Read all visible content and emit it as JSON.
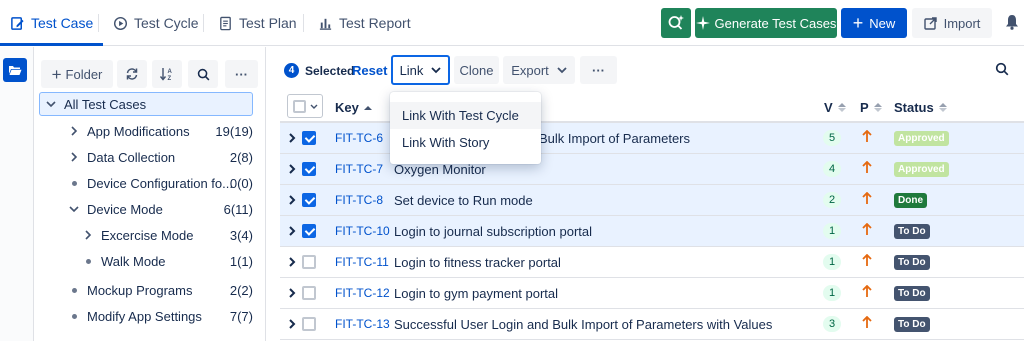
{
  "tabs": [
    {
      "label": "Test Case",
      "active": true
    },
    {
      "label": "Test Cycle"
    },
    {
      "label": "Test Plan"
    },
    {
      "label": "Test Report"
    }
  ],
  "actions": {
    "generate_label": "Generate Test Cases",
    "new_label": "New",
    "import_label": "Import"
  },
  "tree": {
    "folder_label": "Folder",
    "items": [
      {
        "label": "All Test Cases",
        "count": "",
        "level": 0,
        "state": "expanded",
        "selected": true
      },
      {
        "label": "App Modifications",
        "count": "19(19)",
        "level": 1,
        "state": "collapsed"
      },
      {
        "label": "Data Collection",
        "count": "2(8)",
        "level": 1,
        "state": "collapsed"
      },
      {
        "label": "Device Configuration fo...",
        "count": "0(0)",
        "level": 1,
        "state": "leaf"
      },
      {
        "label": "Device Mode",
        "count": "6(11)",
        "level": 1,
        "state": "expanded"
      },
      {
        "label": "Excercise Mode",
        "count": "3(4)",
        "level": 2,
        "state": "collapsed"
      },
      {
        "label": "Walk Mode",
        "count": "1(1)",
        "level": 2,
        "state": "leaf"
      },
      {
        "label": "Mockup Programs",
        "count": "2(2)",
        "level": 1,
        "state": "leaf"
      },
      {
        "label": "Modify App Settings",
        "count": "7(7)",
        "level": 1,
        "state": "leaf"
      }
    ]
  },
  "toolbar": {
    "selected_count": "4",
    "selected_label": "Selected",
    "reset_label": "Reset",
    "link_label": "Link",
    "clone_label": "Clone",
    "export_label": "Export"
  },
  "table": {
    "headers": {
      "key": "Key",
      "v": "V",
      "p": "P",
      "status": "Status"
    },
    "rows": [
      {
        "key": "FIT-TC-6",
        "summary": "Bulk Import of Parameters",
        "version": "5",
        "status": "Approved",
        "status_color": "#c1e4a0",
        "checked": true
      },
      {
        "key": "FIT-TC-7",
        "summary": "Oxygen Monitor",
        "version": "4",
        "status": "Approved",
        "status_color": "#c1e4a0",
        "checked": true
      },
      {
        "key": "FIT-TC-8",
        "summary": "Set device to Run mode",
        "version": "2",
        "status": "Done",
        "status_color": "#1f7a3c",
        "checked": true
      },
      {
        "key": "FIT-TC-10",
        "summary": "Login to journal subscription portal",
        "version": "1",
        "status": "To Do",
        "status_color": "#44546f",
        "checked": true
      },
      {
        "key": "FIT-TC-11",
        "summary": "Login to fitness tracker portal",
        "version": "1",
        "status": "To Do",
        "status_color": "#44546f",
        "checked": false
      },
      {
        "key": "FIT-TC-12",
        "summary": "Login to gym payment portal",
        "version": "1",
        "status": "To Do",
        "status_color": "#44546f",
        "checked": false
      },
      {
        "key": "FIT-TC-13",
        "summary": "Successful User Login and Bulk Import of Parameters with Values",
        "version": "3",
        "status": "To Do",
        "status_color": "#44546f",
        "checked": false
      }
    ]
  },
  "link_menu": {
    "items": [
      "Link With Test Cycle",
      "Link With Story"
    ]
  },
  "colors": {
    "accent": "#0052cc",
    "ai_green": "#1f845a",
    "priority": "#e56910"
  }
}
